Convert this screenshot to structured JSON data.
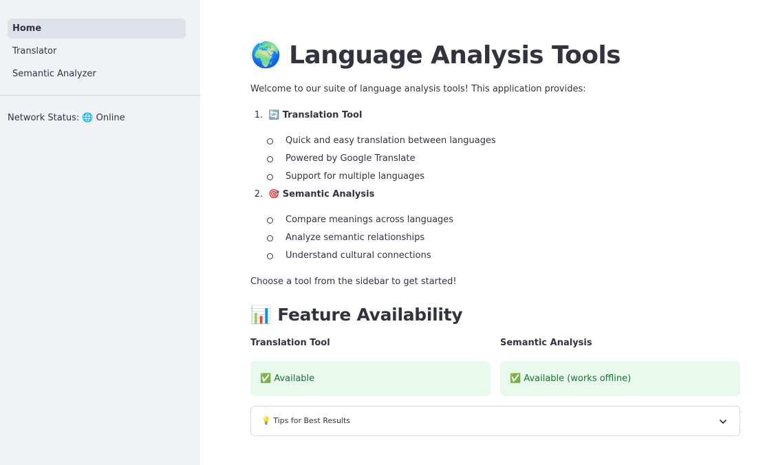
{
  "sidebar": {
    "nav_items": [
      {
        "label": "Home",
        "active": true
      },
      {
        "label": "Translator",
        "active": false
      },
      {
        "label": "Semantic Analyzer",
        "active": false
      }
    ],
    "network_status": "Network Status: 🌐 Online"
  },
  "main": {
    "title": "🌍 Language Analysis Tools",
    "intro": "Welcome to our suite of language analysis tools! This application provides:",
    "tools": [
      {
        "number": "1.",
        "heading": "🔄 Translation Tool",
        "points": [
          "Quick and easy translation between languages",
          "Powered by Google Translate",
          "Support for multiple languages"
        ]
      },
      {
        "number": "2.",
        "heading": "🎯 Semantic Analysis",
        "points": [
          "Compare meanings across languages",
          "Analyze semantic relationships",
          "Understand cultural connections"
        ]
      }
    ],
    "cta": "Choose a tool from the sidebar to get started!",
    "availability": {
      "heading": "📊 Feature Availability",
      "columns": [
        {
          "label": "Translation Tool",
          "status": "✅ Available"
        },
        {
          "label": "Semantic Analysis",
          "status": "✅ Available (works offline)"
        }
      ]
    },
    "expander": {
      "label": "💡 Tips for Best Results",
      "icon": "chevron-down-icon"
    }
  },
  "colors": {
    "sidebar_bg": "#f0f2f6",
    "nav_active_bg": "#dde1ea",
    "text": "#31333f",
    "success_bg": "#e8f9ee",
    "success_text": "#177233"
  }
}
